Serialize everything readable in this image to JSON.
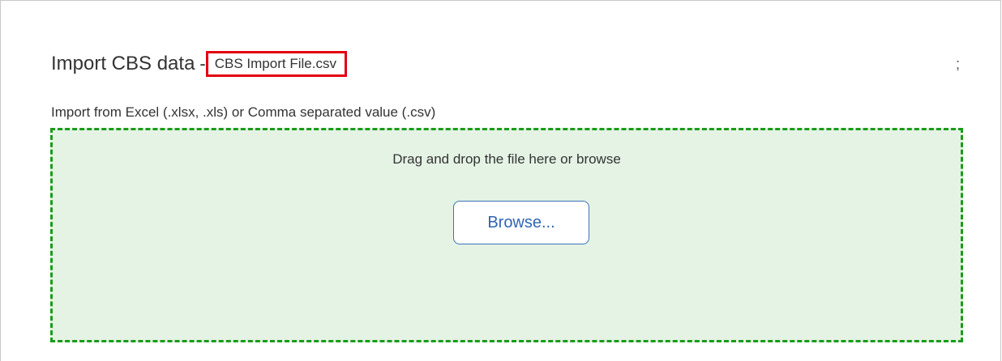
{
  "dialog": {
    "title": "Import CBS data",
    "title_separator": "-",
    "file_name": "CBS Import File.csv",
    "menu_glyph": ";",
    "subtitle": "Import from Excel (.xlsx, .xls) or Comma separated value (.csv)"
  },
  "dropzone": {
    "hint": "Drag and drop the file here or browse",
    "browse_label": "Browse..."
  },
  "colors": {
    "highlight_border": "#e3000f",
    "dropzone_border": "#1a9c1a",
    "dropzone_background": "#e5f3e5",
    "button_text": "#2f66b3",
    "button_border": "#3b73b9"
  }
}
